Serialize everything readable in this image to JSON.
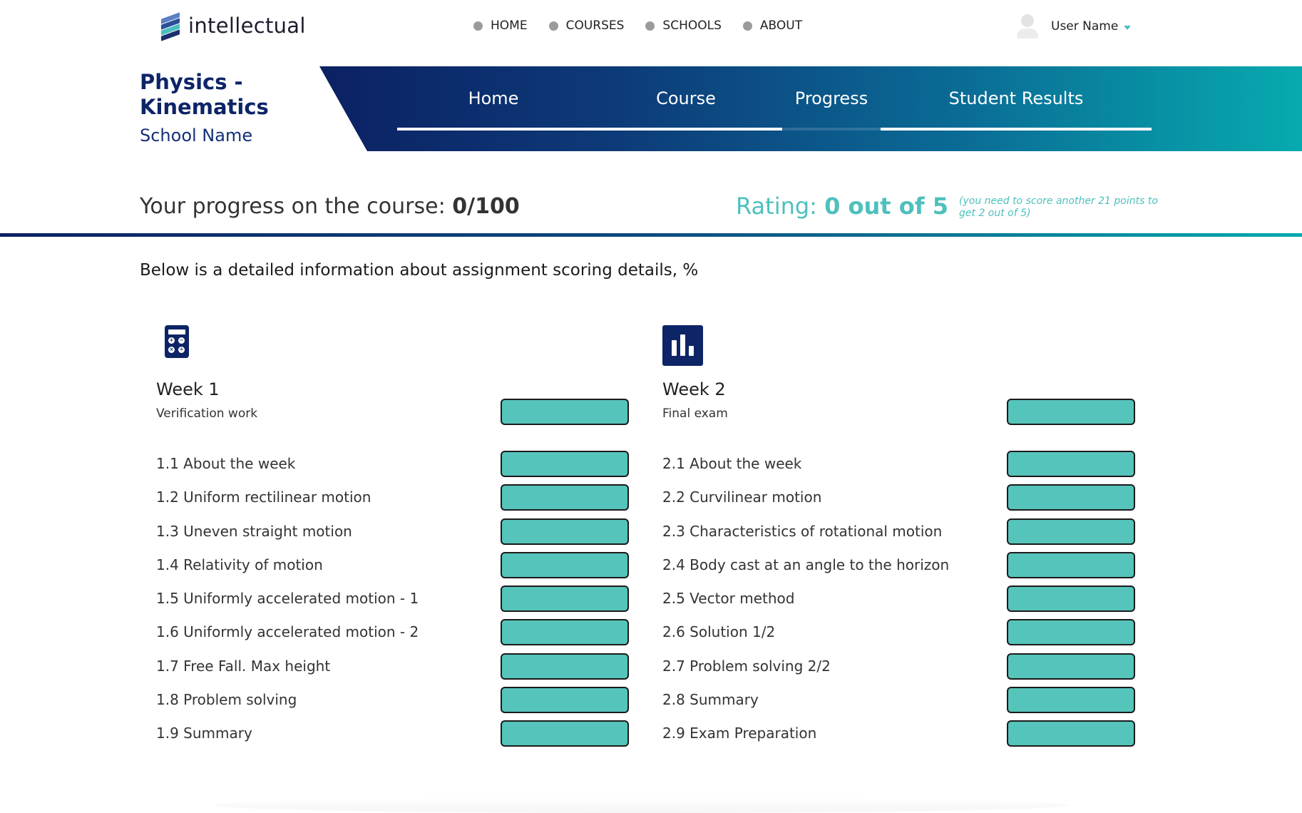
{
  "brand": {
    "name": "intellectual"
  },
  "nav": {
    "items": [
      "HOME",
      "COURSES",
      "SCHOOLS",
      "ABOUT"
    ]
  },
  "user": {
    "name": "User Name"
  },
  "course": {
    "title": "Physics - Kinematics",
    "school": "School Name"
  },
  "tabs": [
    {
      "label": "Home",
      "active": false
    },
    {
      "label": "Course",
      "active": false
    },
    {
      "label": "Progress",
      "active": true
    },
    {
      "label": "Student Results",
      "active": false
    }
  ],
  "progress": {
    "label": "Your progress on the course:",
    "value": "0/100"
  },
  "rating": {
    "label": "Rating:",
    "value": "0 out of 5",
    "note": "(you need to score another 21 points to get 2 out of 5)"
  },
  "intro": "Below is a detailed information about assignment scoring details, %",
  "weeks": [
    {
      "title": "Week 1",
      "subtitle": "Verification work",
      "icon": "calculator-icon",
      "items": [
        "1.1 About the week",
        "1.2 Uniform rectilinear motion",
        "1.3 Uneven straight motion",
        "1.4 Relativity of motion",
        "1.5 Uniformly accelerated motion - 1",
        "1.6 Uniformly accelerated motion - 2",
        "1.7 Free Fall. Max height",
        "1.8 Problem solving",
        "1.9 Summary"
      ]
    },
    {
      "title": "Week 2",
      "subtitle": "Final exam",
      "icon": "bar-chart-icon",
      "items": [
        "2.1 About the week",
        "2.2 Curvilinear motion",
        "2.3 Characteristics of rotational motion",
        "2.4 Body cast at an angle to the horizon",
        "2.5 Vector method",
        "2.6 Solution 1/2",
        "2.7 Problem solving 2/2",
        "2.8 Summary",
        "2.9 Exam Preparation"
      ]
    }
  ],
  "colors": {
    "navy": "#0d2467",
    "teal": "#4ec0bd",
    "bar_fill": "#55c4ba"
  }
}
